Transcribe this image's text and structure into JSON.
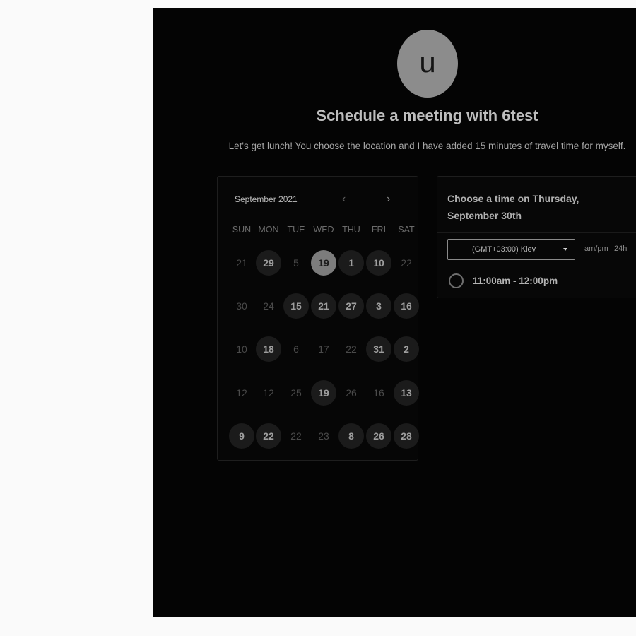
{
  "host": {
    "avatar_letter": "u"
  },
  "header": {
    "title": "Schedule a meeting with 6test",
    "description": "Let's get lunch! You choose the location and I have added 15 minutes of travel time for myself."
  },
  "calendar": {
    "month_label": "September 2021",
    "prev_icon": "‹",
    "next_icon": "›",
    "weekdays": [
      "SUN",
      "MON",
      "TUE",
      "WED",
      "THU",
      "FRI",
      "SAT"
    ],
    "weeks": [
      [
        {
          "d": "21",
          "s": "muted"
        },
        {
          "d": "29",
          "s": "avail"
        },
        {
          "d": "5",
          "s": "muted"
        },
        {
          "d": "19",
          "s": "sel"
        },
        {
          "d": "1",
          "s": "avail"
        },
        {
          "d": "10",
          "s": "avail"
        },
        {
          "d": "22",
          "s": "muted"
        }
      ],
      [
        {
          "d": "30",
          "s": "muted"
        },
        {
          "d": "24",
          "s": "muted"
        },
        {
          "d": "15",
          "s": "avail"
        },
        {
          "d": "21",
          "s": "avail"
        },
        {
          "d": "27",
          "s": "avail"
        },
        {
          "d": "3",
          "s": "avail"
        },
        {
          "d": "16",
          "s": "avail"
        }
      ],
      [
        {
          "d": "10",
          "s": "muted"
        },
        {
          "d": "18",
          "s": "avail"
        },
        {
          "d": "6",
          "s": "muted"
        },
        {
          "d": "17",
          "s": "muted"
        },
        {
          "d": "22",
          "s": "muted"
        },
        {
          "d": "31",
          "s": "avail"
        },
        {
          "d": "2",
          "s": "avail"
        }
      ],
      [
        {
          "d": "12",
          "s": "muted"
        },
        {
          "d": "12",
          "s": "muted"
        },
        {
          "d": "25",
          "s": "muted"
        },
        {
          "d": "19",
          "s": "avail"
        },
        {
          "d": "26",
          "s": "muted"
        },
        {
          "d": "16",
          "s": "muted"
        },
        {
          "d": "13",
          "s": "avail"
        }
      ],
      [
        {
          "d": "9",
          "s": "avail"
        },
        {
          "d": "22",
          "s": "avail"
        },
        {
          "d": "22",
          "s": "muted"
        },
        {
          "d": "23",
          "s": "muted"
        },
        {
          "d": "8",
          "s": "avail"
        },
        {
          "d": "26",
          "s": "avail"
        },
        {
          "d": "28",
          "s": "avail"
        }
      ]
    ]
  },
  "times": {
    "heading": "Choose a time on Thursday, September 30th",
    "timezone": "(GMT+03:00) Kiev",
    "format_ampm": "am/pm",
    "format_24h": "24h",
    "slots": [
      {
        "label": "11:00am - 12:00pm"
      }
    ]
  }
}
